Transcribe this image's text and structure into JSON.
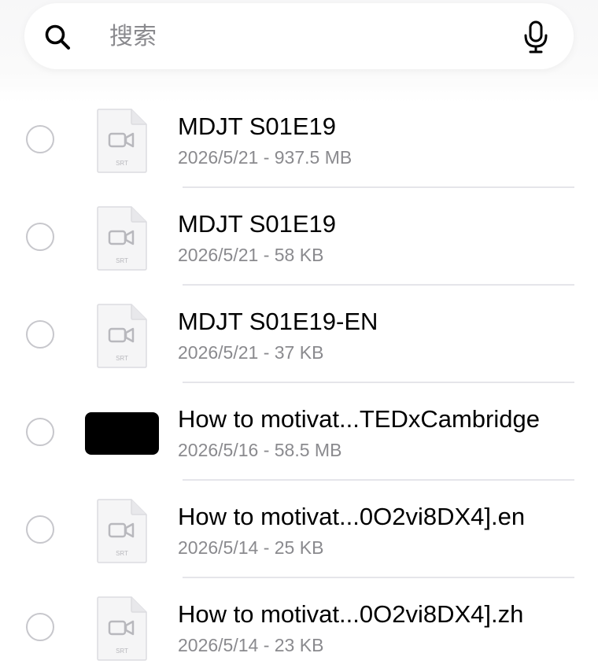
{
  "search": {
    "placeholder": "搜索"
  },
  "colors": {
    "text_primary": "#000000",
    "text_secondary": "#8a8a8e",
    "circle_border": "#c7c7cc",
    "divider": "#e5e5ea"
  },
  "files": [
    {
      "name": "MDJT S01E19",
      "meta": "2026/5/21 - 937.5 MB",
      "thumb_label": "SRT",
      "thumb_type": "doc-video"
    },
    {
      "name": "MDJT S01E19",
      "meta": "2026/5/21 - 58 KB",
      "thumb_label": "SRT",
      "thumb_type": "doc-video"
    },
    {
      "name": "MDJT S01E19-EN",
      "meta": "2026/5/21 - 37 KB",
      "thumb_label": "SRT",
      "thumb_type": "doc-video"
    },
    {
      "name": "How to motivat...TEDxCambridge",
      "meta": "2026/5/16 - 58.5 MB",
      "thumb_label": "",
      "thumb_type": "video-black"
    },
    {
      "name": "How to motivat...0O2vi8DX4].en",
      "meta": "2026/5/14 - 25 KB",
      "thumb_label": "SRT",
      "thumb_type": "doc-video"
    },
    {
      "name": "How to motivat...0O2vi8DX4].zh",
      "meta": "2026/5/14 - 23 KB",
      "thumb_label": "SRT",
      "thumb_type": "doc-video"
    }
  ]
}
